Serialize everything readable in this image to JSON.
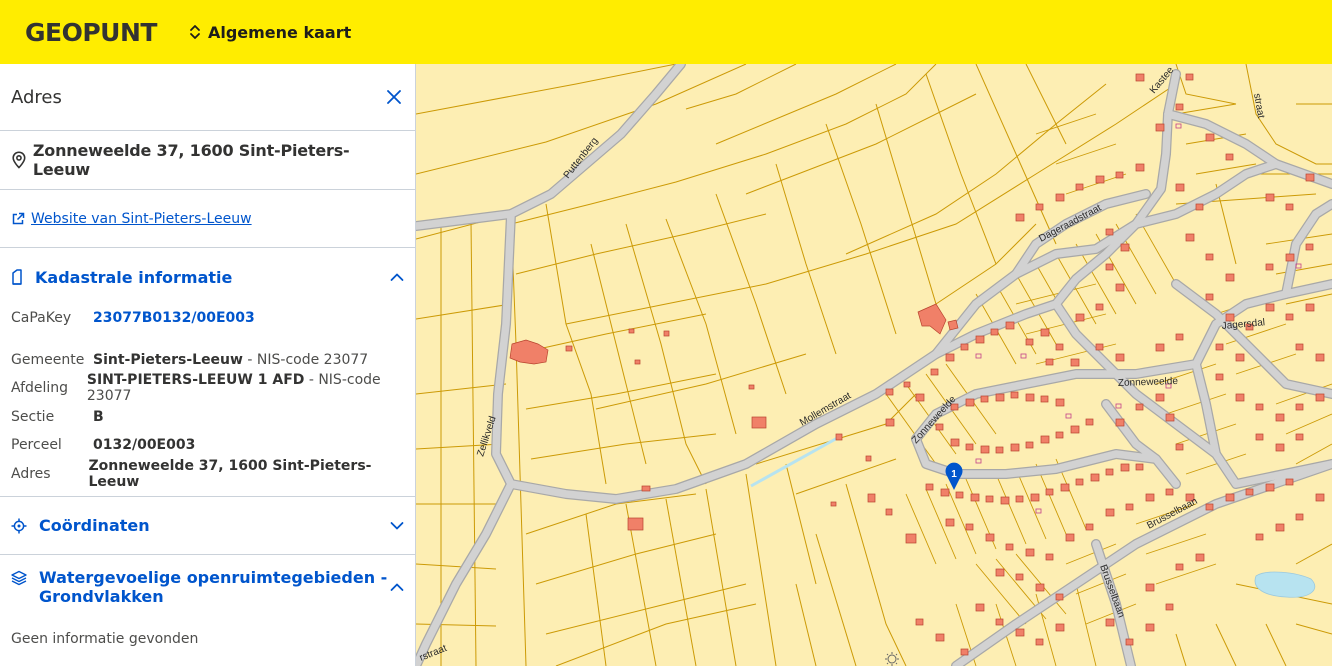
{
  "header": {
    "logo": "GEOPUNT",
    "map_selector_label": "Algemene kaart",
    "background_color": "#ffed00"
  },
  "panel": {
    "title": "Adres",
    "address": "Zonneweelde 37, 1600 Sint-Pieters-Leeuw",
    "website_link": "Website van Sint-Pieters-Leeuw",
    "sections": {
      "kadaster": {
        "title": "Kadastrale informatie",
        "fields": {
          "capakey_label": "CaPaKey",
          "capakey_value": "23077B0132/00E003",
          "gemeente_label": "Gemeente",
          "gemeente_value": "Sint-Pieters-Leeuw",
          "gemeente_nis": " - NIS-code 23077",
          "afdeling_label": "Afdeling",
          "afdeling_value": "SINT-PIETERS-LEEUW 1 AFD",
          "afdeling_nis": " - NIS-code 23077",
          "sectie_label": "Sectie",
          "sectie_value": "B",
          "perceel_label": "Perceel",
          "perceel_value": "0132/00E003",
          "adres_label": "Adres",
          "adres_value": "Zonneweelde 37, 1600 Sint-Pieters-Leeuw"
        }
      },
      "coordinaten": {
        "title": "Coördinaten"
      },
      "water": {
        "title_line1": "Watergevoelige openruimtegebieden -",
        "title_line2": "Grondvlakken",
        "no_info": "Geen informatie gevonden"
      }
    },
    "accent_color": "#0055cc"
  },
  "map": {
    "marker_label": "1",
    "street_labels": {
      "puttenberg": "Puttenberg",
      "dageraadstraat": "Dageraadstraat",
      "kasteel": "Kastee",
      "straat_ne": "straat",
      "jagersdal": "Jagersdal",
      "zonneweelde_1": "Zonneweelde",
      "zonneweelde_2": "Zonneweelde",
      "mollemstraat": "Mollemstraat",
      "zellikveld": "Zellikveld",
      "brusselbaan_1": "Brusselbaan",
      "brusselbaan_2": "Brusselbaan",
      "straat_sw": "rstraat"
    },
    "colors": {
      "parcel_fill": "#fdeeb3",
      "parcel_line": "#cc9a06",
      "building": "#f08068",
      "road": "#c9c9c9",
      "water": "#b7e3f0",
      "marker": "#0055cc"
    }
  }
}
